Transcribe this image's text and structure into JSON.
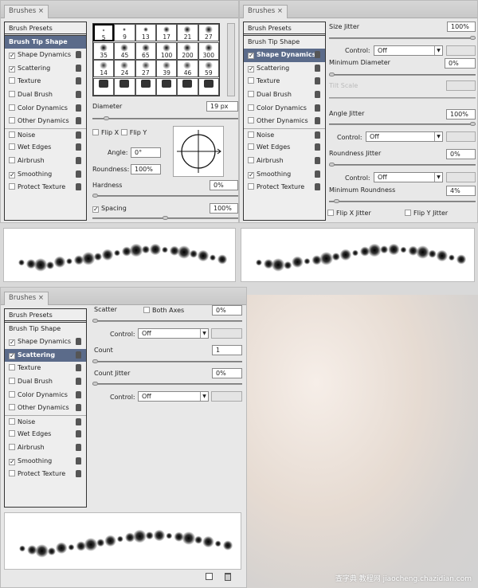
{
  "panels": [
    {
      "tab": "Brushes",
      "items": [
        {
          "label": "Brush Presets",
          "type": "header"
        },
        {
          "label": "Brush Tip Shape",
          "selected": true,
          "nocheck": true
        },
        {
          "label": "Shape Dynamics",
          "checked": true
        },
        {
          "label": "Scattering",
          "checked": true
        },
        {
          "label": "Texture"
        },
        {
          "label": "Dual Brush"
        },
        {
          "label": "Color Dynamics"
        },
        {
          "label": "Other Dynamics"
        },
        {
          "label": "Noise",
          "sep": true
        },
        {
          "label": "Wet Edges"
        },
        {
          "label": "Airbrush"
        },
        {
          "label": "Smoothing",
          "checked": true
        },
        {
          "label": "Protect Texture"
        }
      ]
    },
    {
      "tab": "Brushes",
      "items": [
        {
          "label": "Brush Presets",
          "type": "header"
        },
        {
          "label": "Brush Tip Shape",
          "nocheck": true
        },
        {
          "label": "Shape Dynamics",
          "checked": true,
          "selected": true
        },
        {
          "label": "Scattering",
          "checked": true
        },
        {
          "label": "Texture"
        },
        {
          "label": "Dual Brush"
        },
        {
          "label": "Color Dynamics"
        },
        {
          "label": "Other Dynamics"
        },
        {
          "label": "Noise",
          "sep": true
        },
        {
          "label": "Wet Edges"
        },
        {
          "label": "Airbrush"
        },
        {
          "label": "Smoothing",
          "checked": true
        },
        {
          "label": "Protect Texture"
        }
      ]
    },
    {
      "tab": "Brushes",
      "items": [
        {
          "label": "Brush Presets",
          "type": "header"
        },
        {
          "label": "Brush Tip Shape",
          "nocheck": true
        },
        {
          "label": "Shape Dynamics",
          "checked": true
        },
        {
          "label": "Scattering",
          "checked": true,
          "selected": true
        },
        {
          "label": "Texture"
        },
        {
          "label": "Dual Brush"
        },
        {
          "label": "Color Dynamics"
        },
        {
          "label": "Other Dynamics"
        },
        {
          "label": "Noise",
          "sep": true
        },
        {
          "label": "Wet Edges"
        },
        {
          "label": "Airbrush"
        },
        {
          "label": "Smoothing",
          "checked": true
        },
        {
          "label": "Protect Texture"
        }
      ]
    }
  ],
  "tip": {
    "brush_sizes": [
      "5",
      "9",
      "13",
      "17",
      "21",
      "27",
      "35",
      "45",
      "65",
      "100",
      "200",
      "300",
      "14",
      "24",
      "27",
      "39",
      "46",
      "59"
    ],
    "diameter_label": "Diameter",
    "diameter": "19 px",
    "flip_x": "Flip X",
    "flip_y": "Flip Y",
    "angle_label": "Angle:",
    "angle": "0°",
    "roundness_label": "Roundness:",
    "roundness": "100%",
    "hardness_label": "Hardness",
    "hardness": "0%",
    "spacing_label": "Spacing",
    "spacing": "100%"
  },
  "shape": {
    "size_jitter_label": "Size Jitter",
    "size_jitter": "100%",
    "control_label": "Control:",
    "control1": "Off",
    "min_diameter_label": "Minimum Diameter",
    "min_diameter": "0%",
    "tilt_scale_label": "Tilt Scale",
    "angle_jitter_label": "Angle Jitter",
    "angle_jitter": "100%",
    "control2": "Off",
    "roundness_jitter_label": "Roundness Jitter",
    "roundness_jitter": "0%",
    "control3": "Off",
    "min_roundness_label": "Minimum Roundness",
    "min_roundness": "4%",
    "flip_x_jitter": "Flip X Jitter",
    "flip_y_jitter": "Flip Y Jitter"
  },
  "scatter": {
    "scatter_label": "Scatter",
    "both_axes": "Both Axes",
    "scatter": "0%",
    "control_label": "Control:",
    "control1": "Off",
    "count_label": "Count",
    "count": "1",
    "count_jitter_label": "Count Jitter",
    "count_jitter": "0%",
    "control2": "Off"
  },
  "watermark": "查字典 教程网 jiaocheng.chazidian.com"
}
